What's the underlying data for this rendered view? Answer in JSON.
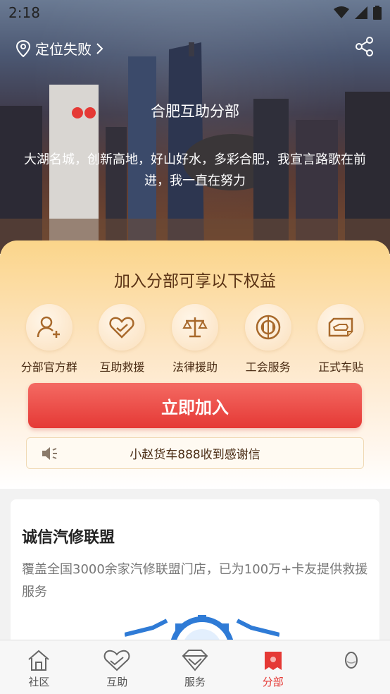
{
  "status_bar": {
    "time": "2:18"
  },
  "header": {
    "location_text": "定位失败",
    "title": "合肥互助分部",
    "description": "大湖名城，创新高地，好山好水，多彩合肥，我宣言路歌在前进，我一直在努力"
  },
  "benefits": {
    "title": "加入分部可享以下权益",
    "items": [
      {
        "label": "分部官方群",
        "icon": "user-add-icon"
      },
      {
        "label": "互助救援",
        "icon": "heart-icon"
      },
      {
        "label": "法律援助",
        "icon": "scales-icon"
      },
      {
        "label": "工会服务",
        "icon": "union-icon"
      },
      {
        "label": "正式车贴",
        "icon": "car-sticker-icon"
      }
    ],
    "join_label": "立即加入",
    "notice_text": "小赵货车888收到感谢信"
  },
  "alliance": {
    "title": "诚信汽修联盟",
    "description": "覆盖全国3000余家汽修联盟门店，已为100万+卡友提供救援服务"
  },
  "tabs": [
    {
      "label": "社区",
      "icon": "home-icon",
      "active": false
    },
    {
      "label": "互助",
      "icon": "handshake-heart-icon",
      "active": false
    },
    {
      "label": "服务",
      "icon": "diamond-icon",
      "active": false
    },
    {
      "label": "分部",
      "icon": "branch-icon",
      "active": true
    },
    {
      "label": "",
      "icon": "profile-icon",
      "active": false
    }
  ],
  "colors": {
    "accent": "#e53935",
    "benefit_text": "#4a2c14",
    "tab_active": "#e53935"
  }
}
